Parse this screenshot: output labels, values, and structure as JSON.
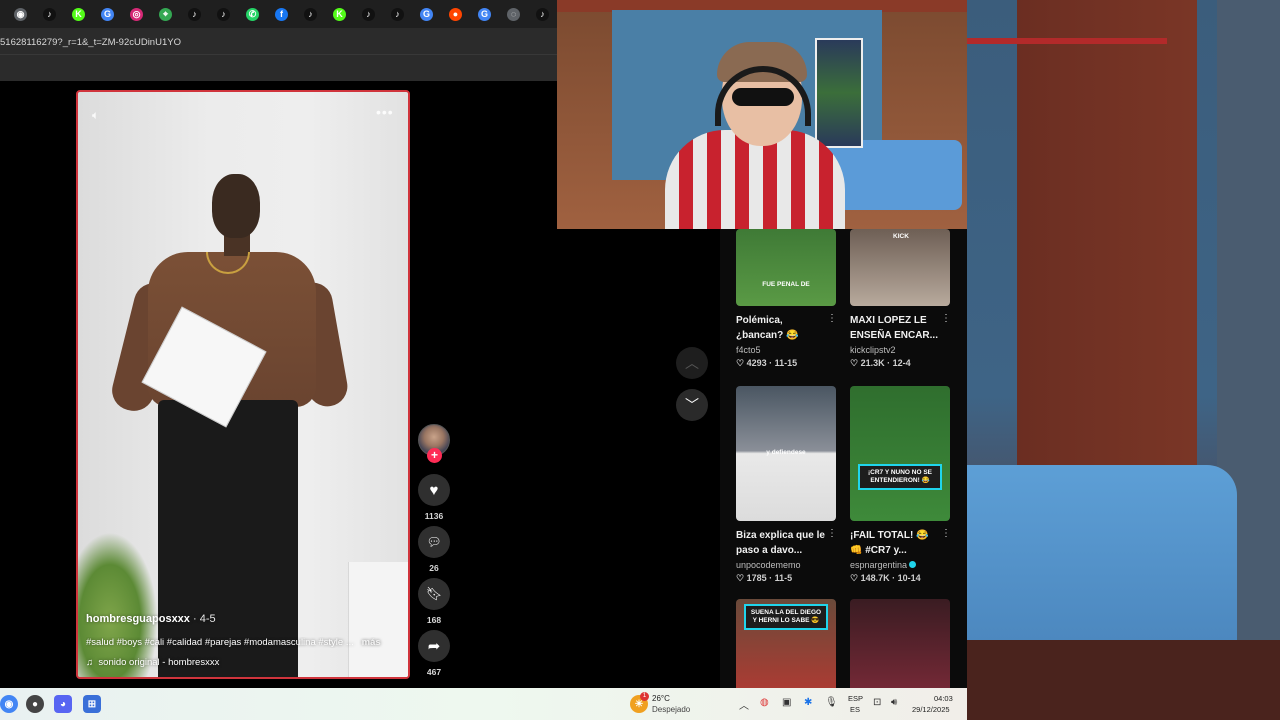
{
  "browser": {
    "tab_icons": [
      {
        "name": "chrome-icon",
        "color": "#5f6368",
        "glyph": "◉"
      },
      {
        "name": "tiktok-icon",
        "color": "#111111",
        "glyph": "♪"
      },
      {
        "name": "kick-icon",
        "color": "#53fc18",
        "glyph": "K"
      },
      {
        "name": "google-icon",
        "color": "#4285f4",
        "glyph": "G"
      },
      {
        "name": "instagram-icon",
        "color": "#d62976",
        "glyph": "◎"
      },
      {
        "name": "maps-icon",
        "color": "#34a853",
        "glyph": "⌖"
      },
      {
        "name": "tiktok-icon",
        "color": "#111111",
        "glyph": "♪"
      },
      {
        "name": "tiktok-icon",
        "color": "#111111",
        "glyph": "♪"
      },
      {
        "name": "whatsapp-icon",
        "color": "#25d366",
        "glyph": "✆"
      },
      {
        "name": "facebook-icon",
        "color": "#1877f2",
        "glyph": "f"
      },
      {
        "name": "tiktok-icon",
        "color": "#111111",
        "glyph": "♪"
      },
      {
        "name": "kick-icon",
        "color": "#53fc18",
        "glyph": "K"
      },
      {
        "name": "tiktok-icon",
        "color": "#111111",
        "glyph": "♪"
      },
      {
        "name": "tiktok-icon",
        "color": "#111111",
        "glyph": "♪"
      },
      {
        "name": "google-icon",
        "color": "#4285f4",
        "glyph": "G"
      },
      {
        "name": "reddit-icon",
        "color": "#ff4500",
        "glyph": "●"
      },
      {
        "name": "google-icon",
        "color": "#4285f4",
        "glyph": "G"
      },
      {
        "name": "globe-icon",
        "color": "#5f6368",
        "glyph": "◌"
      },
      {
        "name": "tiktok-icon",
        "color": "#111111",
        "glyph": "♪"
      }
    ],
    "url": "51628116279?_r=1&_t=ZM-92cUDinU1YO"
  },
  "video": {
    "author": "hombresguaposxxx",
    "date_sep": " · 4-5",
    "caption": "#salud #boys #cali #calidad #parejas #modamasculina #style ...",
    "more": "más",
    "sound": "sonido original - hombresxxx",
    "likes": "1136",
    "comments": "26",
    "saves": "168",
    "shares": "467",
    "border_color": "#d0343c"
  },
  "recommendations": [
    {
      "title": "Polémica, ¿bancan? 😂",
      "author": "f4cto5",
      "likes": "4293",
      "date": "11-15",
      "thumb_text": "FUE PENAL DE",
      "verified": false
    },
    {
      "title": "MAXI LOPEZ LE ENSEÑA ENCAR...",
      "author": "kickclipstv2",
      "likes": "21.3K",
      "date": "12-4",
      "thumb_text": "KICK",
      "verified": false
    },
    {
      "title": "Biza explica que le paso a davo...",
      "author": "unpocodememo",
      "likes": "1785",
      "date": "11-5",
      "thumb_text": "y defiendese",
      "verified": false
    },
    {
      "title": "¡FAIL TOTAL! 😂 👊 #CR7 y...",
      "author": "espnargentina",
      "likes": "148.7K",
      "date": "10-14",
      "thumb_text": "¡CR7 Y NUNO NO SE ENTENDIERON! 😂",
      "verified": true
    },
    {
      "title": "",
      "author": "",
      "likes": "",
      "date": "",
      "thumb_text": "SUENA LA DEL DIEGO Y HERNI LO SABE 😎",
      "verified": false
    },
    {
      "title": "",
      "author": "",
      "likes": "",
      "date": "",
      "thumb_text": "",
      "verified": false
    }
  ],
  "taskbar": {
    "weather_temp": "26°C",
    "weather_desc": "Despejado",
    "weather_badge": "1",
    "lang_top": "ESP",
    "lang_bottom": "ES",
    "time": "04:03",
    "date": "29/12/2025"
  }
}
